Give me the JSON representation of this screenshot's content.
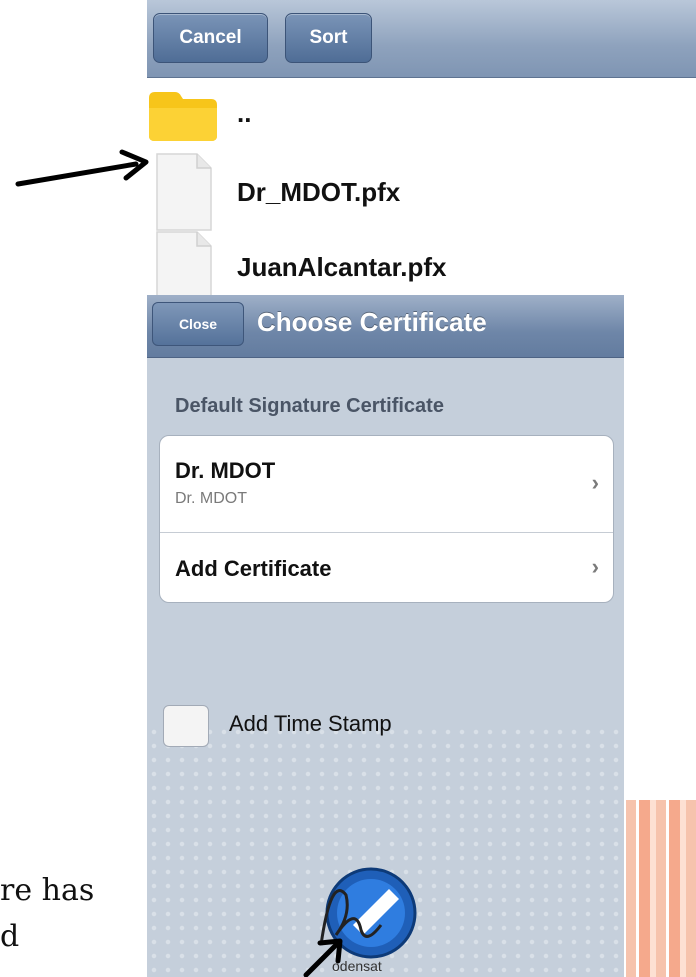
{
  "file_browser": {
    "buttons": {
      "cancel": "Cancel",
      "sort": "Sort"
    },
    "items": [
      {
        "label": "..",
        "icon": "folder-icon"
      },
      {
        "label": "Dr_MDOT.pfx",
        "icon": "document-icon"
      },
      {
        "label": "JuanAlcantar.pfx",
        "icon": "document-icon"
      }
    ]
  },
  "choose_certificate": {
    "close_label": "Close",
    "title": "Choose Certificate",
    "section_header": "Default Signature Certificate",
    "rows": [
      {
        "title": "Dr. MDOT",
        "subtitle": "Dr. MDOT"
      },
      {
        "title": "Add Certificate"
      }
    ],
    "time_stamp_label": "Add Time Stamp",
    "logo_text": "odensat"
  },
  "slide_fragment": {
    "line1": "re has",
    "line2": "d"
  },
  "colors": {
    "nav_bar": "#7f95b3",
    "button": "#4f6d96",
    "panel_bg": "#c5cfdb",
    "folder": "#f7c51a"
  }
}
